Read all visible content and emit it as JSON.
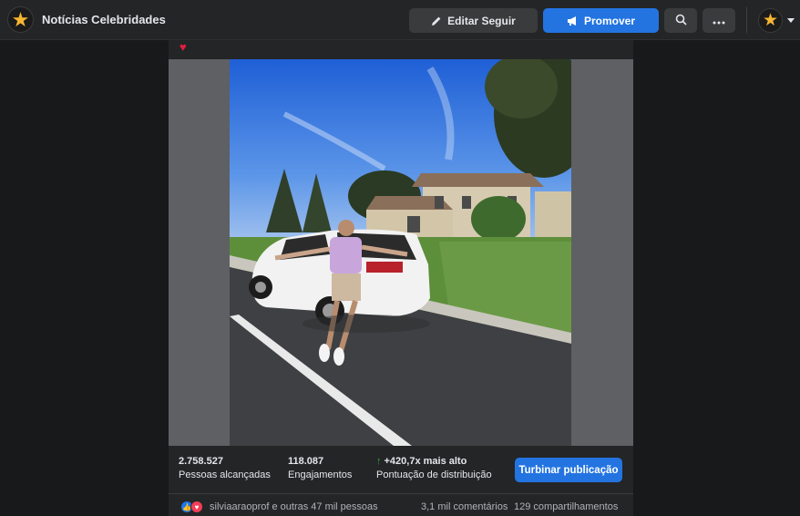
{
  "header": {
    "page_name": "Notícias Celebridades",
    "edit_follow_label": "Editar Seguir",
    "promote_label": "Promover"
  },
  "icons": {
    "page_avatar": "gold-star-logo-icon",
    "edit": "pencil-icon",
    "promote": "megaphone-icon",
    "search": "search-icon",
    "more": "more-dots-icon",
    "account": "gold-star-logo-icon",
    "account_caret": "chevron-down-icon",
    "heart": "red-heart-icon",
    "like": "like-reaction-icon",
    "love": "love-reaction-icon"
  },
  "post": {
    "caption_emoji": "♥",
    "photo_description": "Man with arms outstretched standing next to a white SUV in front of a house"
  },
  "insights": {
    "reach_value": "2.758.527",
    "reach_label": "Pessoas alcançadas",
    "engagement_value": "118.087",
    "engagement_label": "Engajamentos",
    "distribution_value": "+420,7x mais alto",
    "distribution_label": "Pontuação de distribuição",
    "boost_label": "Turbinar publicação"
  },
  "reactions": {
    "names": "silviaaraoprof e outras 47 mil pessoas",
    "comments": "3,1 mil comentários",
    "shares": "129 compartilhamentos"
  },
  "colors": {
    "background": "#18191a",
    "surface": "#242526",
    "primary_button": "#2374e1",
    "secondary_button": "#3a3b3c",
    "positive": "#31a24c"
  }
}
